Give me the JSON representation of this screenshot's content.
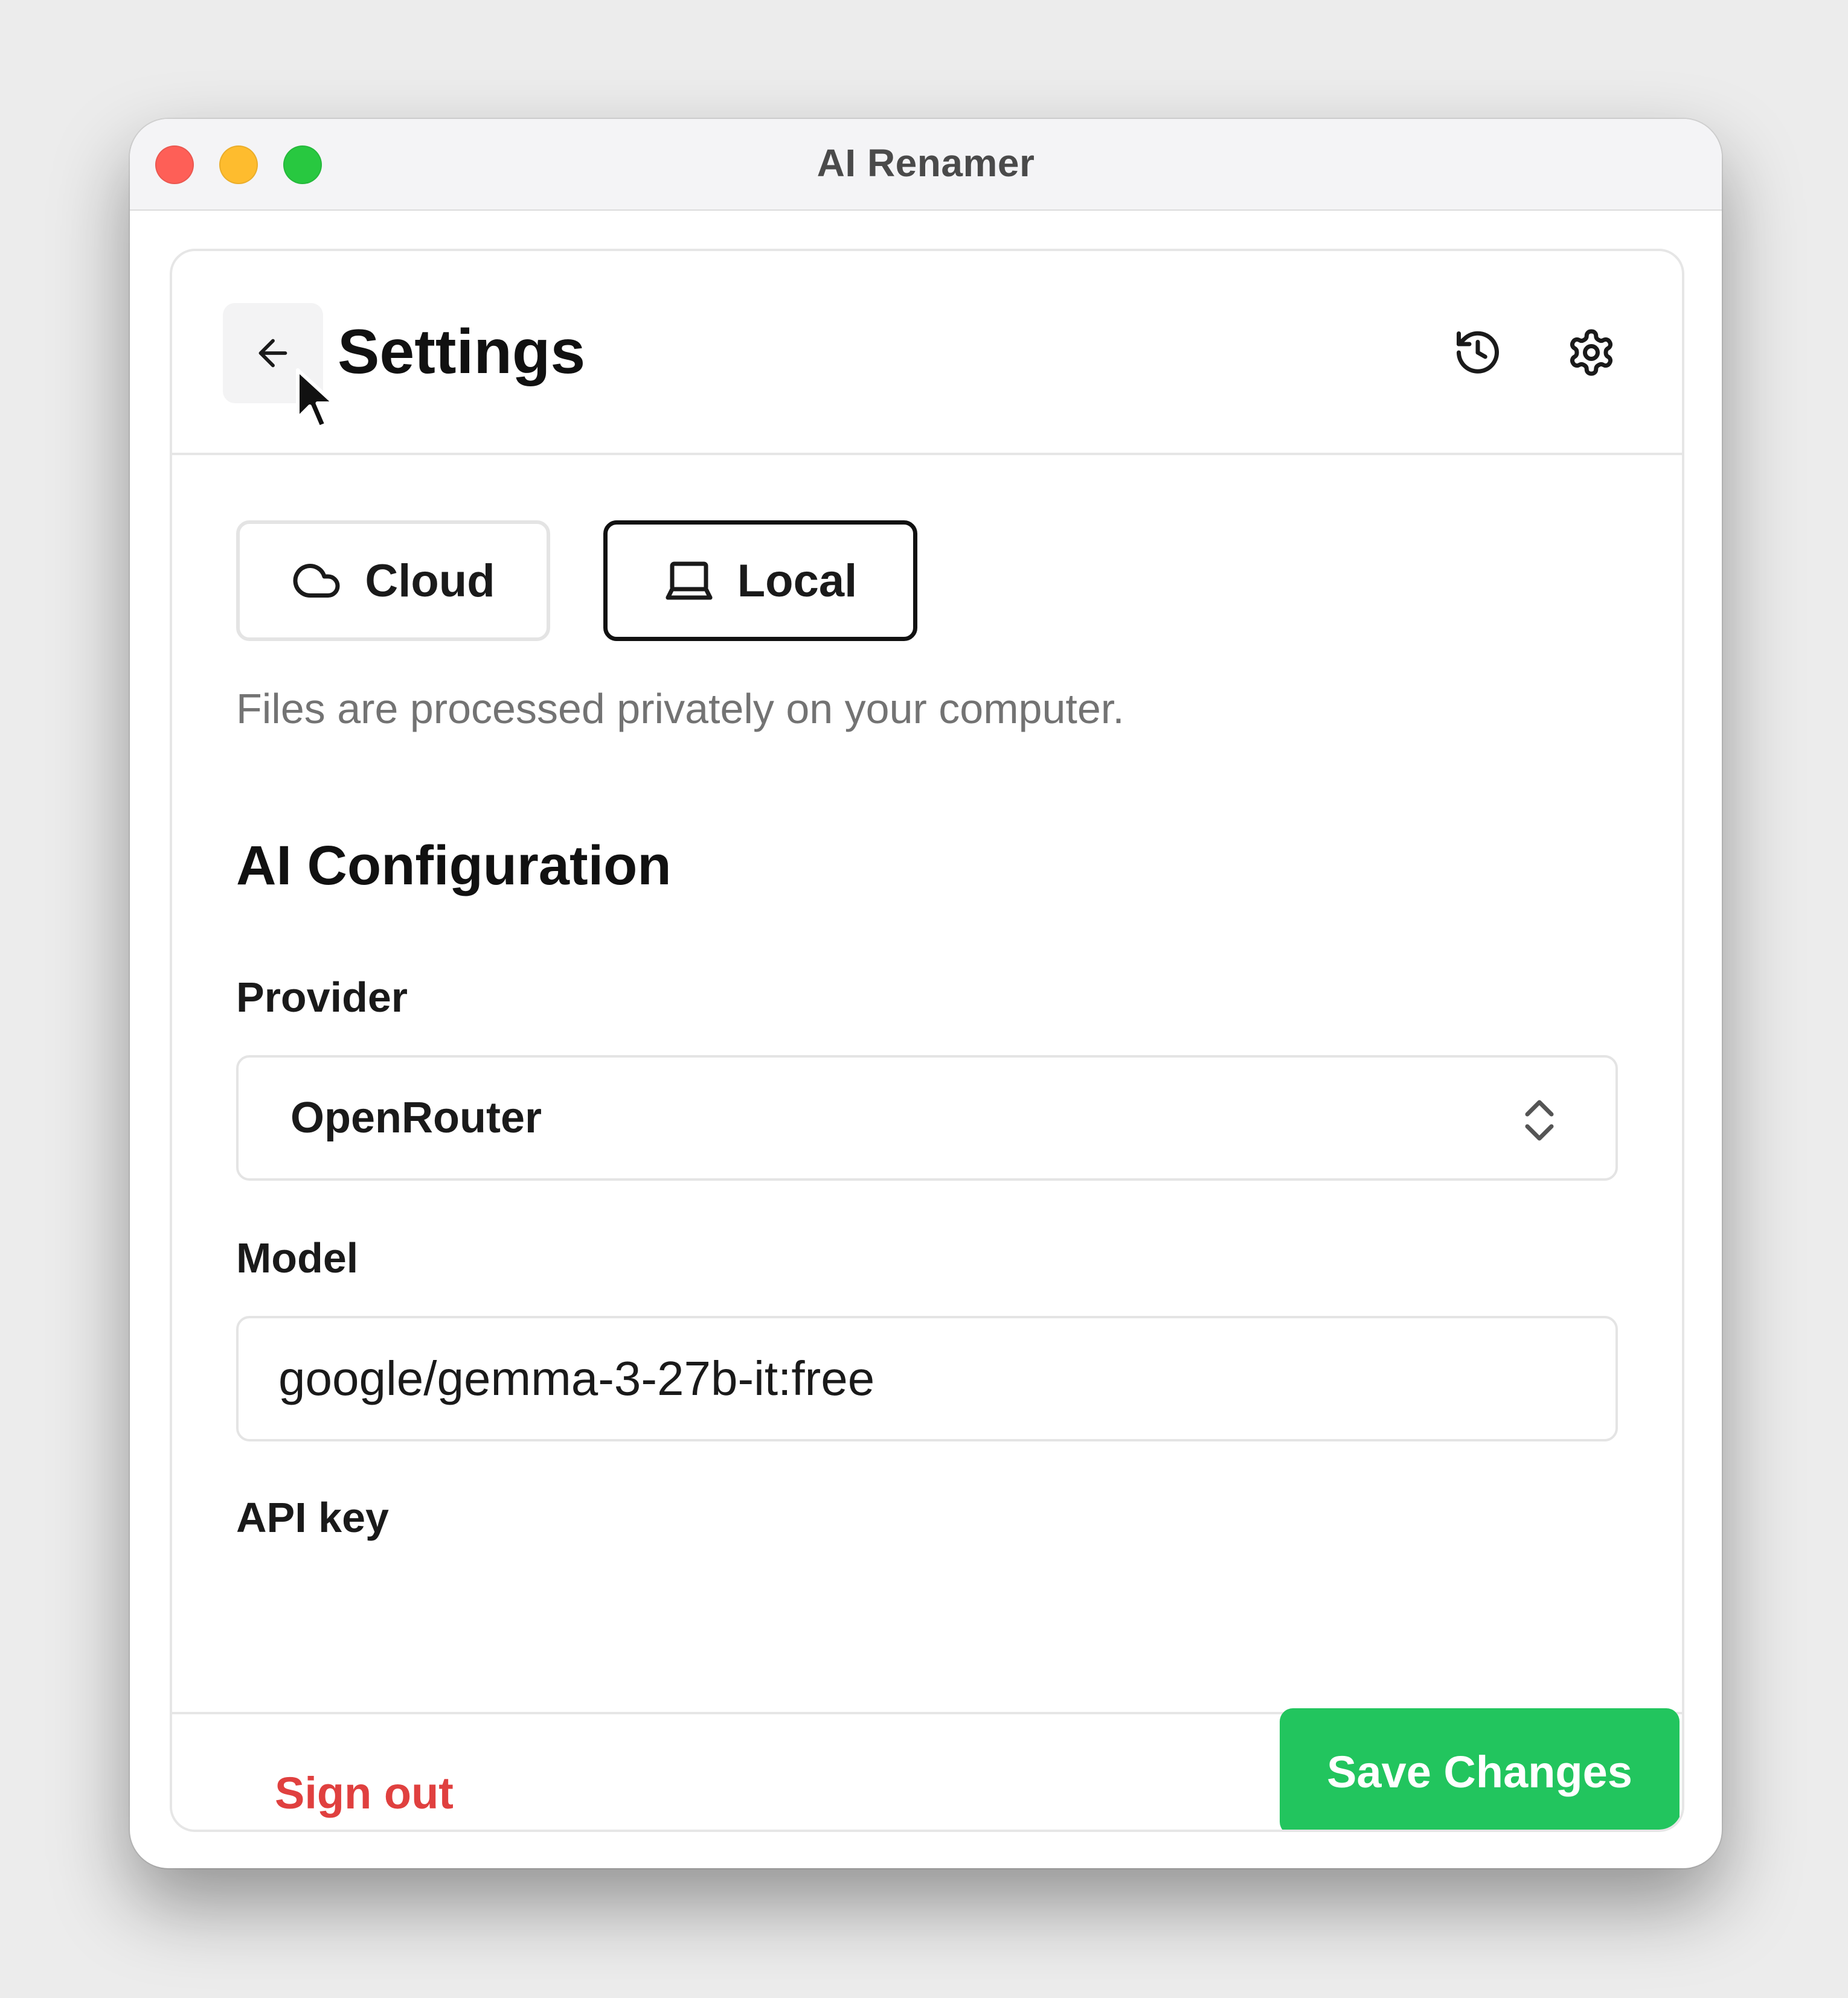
{
  "window": {
    "title": "AI Renamer"
  },
  "header": {
    "title": "Settings",
    "back_icon": "arrow-left-icon",
    "history_icon": "history-icon",
    "gear_icon": "gear-icon"
  },
  "mode": {
    "options": [
      {
        "label": "Cloud",
        "icon": "cloud-icon",
        "selected": false
      },
      {
        "label": "Local",
        "icon": "laptop-icon",
        "selected": true
      }
    ],
    "description": "Files are processed privately on your computer."
  },
  "ai_config": {
    "title": "AI Configuration",
    "provider_label": "Provider",
    "provider_value": "OpenRouter",
    "model_label": "Model",
    "model_value": "google/gemma-3-27b-it:free",
    "api_key_label": "API key"
  },
  "footer": {
    "sign_out_label": "Sign out",
    "save_label": "Save Changes"
  },
  "colors": {
    "save_button": "#22c55e",
    "sign_out": "#e0403f",
    "traffic_close": "#fe5f57",
    "traffic_minimize": "#febc2e",
    "traffic_zoom": "#28c840"
  }
}
